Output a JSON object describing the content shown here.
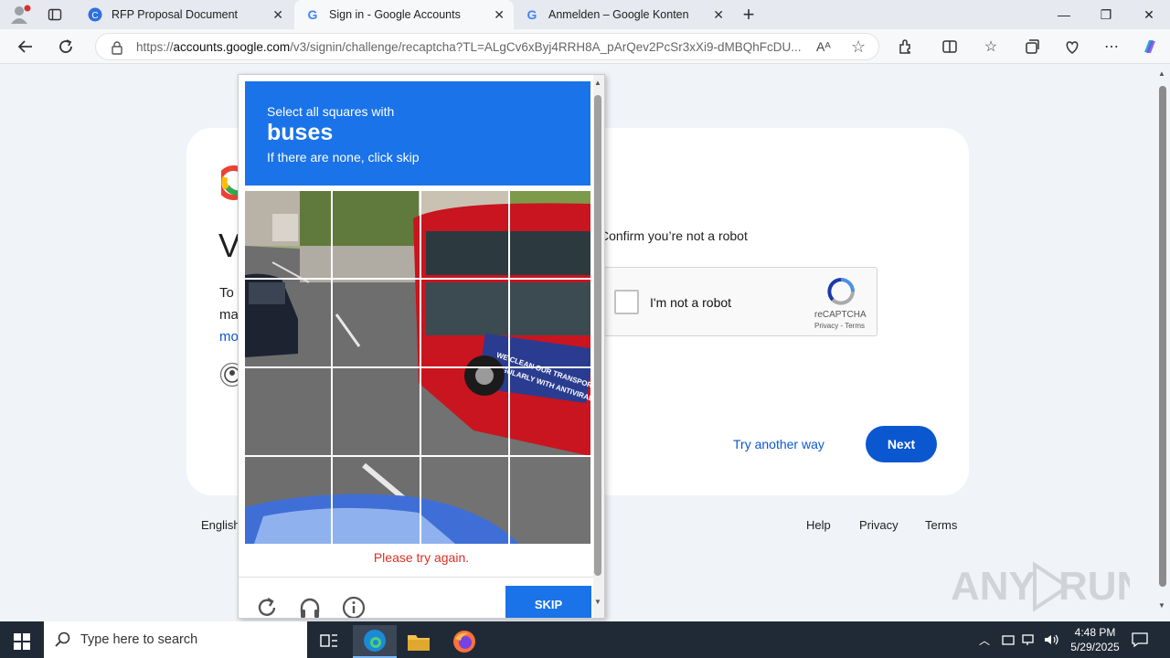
{
  "browser": {
    "tabs": [
      {
        "title": "RFP Proposal Document",
        "active": false
      },
      {
        "title": "Sign in - Google Accounts",
        "active": true
      },
      {
        "title": "Anmelden – Google Konten",
        "active": false
      }
    ],
    "url_prefix": "https://",
    "url_domain": "accounts.google.com",
    "url_path": "/v3/signin/challenge/recaptcha?TL=ALgCv6xByj4RRH8A_pArQev2PcSr3xXi9-dMBQhFcDU...",
    "read_aloud_label": "Aᴬ"
  },
  "page": {
    "heading_partial": "V",
    "body_line1_partial": "To",
    "body_line2_partial": "ma",
    "body_link_partial": "mo",
    "confirm_text": "Confirm you’re not a robot",
    "try_another_way": "Try another way",
    "next_button": "Next",
    "footer_language": "English",
    "footer_help": "Help",
    "footer_privacy": "Privacy",
    "footer_terms": "Terms"
  },
  "recaptcha": {
    "checkbox_label": "I'm not a robot",
    "brand": "reCAPTCHA",
    "privacy": "Privacy",
    "separator": " - ",
    "terms": "Terms"
  },
  "challenge": {
    "instruction_line1": "Select all squares with",
    "target_object": "buses",
    "instruction_line3": "If there are none, click skip",
    "error_text": "Please try again.",
    "skip_button": "SKIP",
    "bus_ad_text": "WE CLEAN OUR TRANSPORT NETWORK REGULARLY WITH ANTIVIRAL DISINFECTANT",
    "grid_rows": 4,
    "grid_cols": 4
  },
  "taskbar": {
    "search_placeholder": "Type here to search",
    "time": "4:48 PM",
    "date": "5/29/2025"
  },
  "watermark": "ANY RUN"
}
